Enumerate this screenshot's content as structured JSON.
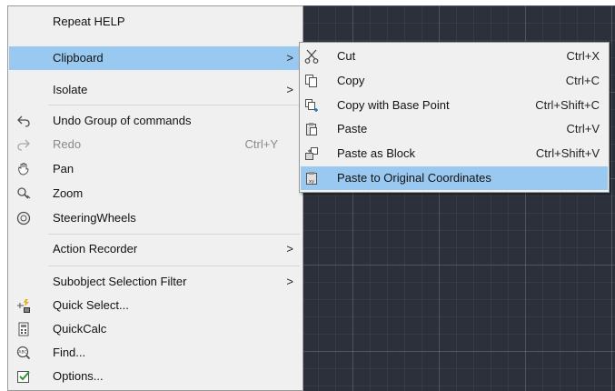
{
  "main_menu": {
    "items": [
      {
        "label": "Repeat HELP",
        "shortcut": "",
        "icon": "",
        "has_submenu": false
      },
      {
        "label": "Clipboard",
        "shortcut": "",
        "icon": "",
        "has_submenu": true,
        "highlighted": true
      },
      {
        "label": "Isolate",
        "shortcut": "",
        "icon": "",
        "has_submenu": true
      },
      {
        "label": "Undo Group of commands",
        "shortcut": "",
        "icon": "undo-icon",
        "has_submenu": false
      },
      {
        "label": "Redo",
        "shortcut": "Ctrl+Y",
        "icon": "redo-icon",
        "has_submenu": false,
        "disabled": true
      },
      {
        "label": "Pan",
        "shortcut": "",
        "icon": "pan-icon",
        "has_submenu": false
      },
      {
        "label": "Zoom",
        "shortcut": "",
        "icon": "zoom-icon",
        "has_submenu": false
      },
      {
        "label": "SteeringWheels",
        "shortcut": "",
        "icon": "steering-wheels-icon",
        "has_submenu": false
      },
      {
        "label": "Action Recorder",
        "shortcut": "",
        "icon": "",
        "has_submenu": true
      },
      {
        "label": "Subobject Selection Filter",
        "shortcut": "",
        "icon": "",
        "has_submenu": true
      },
      {
        "label": "Quick Select...",
        "shortcut": "",
        "icon": "quick-select-icon",
        "has_submenu": false
      },
      {
        "label": "QuickCalc",
        "shortcut": "",
        "icon": "calculator-icon",
        "has_submenu": false
      },
      {
        "label": "Find...",
        "shortcut": "",
        "icon": "find-icon",
        "has_submenu": false
      },
      {
        "label": "Options...",
        "shortcut": "",
        "icon": "options-icon",
        "has_submenu": false
      }
    ],
    "arrow_glyph": ">"
  },
  "clipboard_submenu": {
    "items": [
      {
        "label": "Cut",
        "shortcut": "Ctrl+X",
        "icon": "scissors-icon"
      },
      {
        "label": "Copy",
        "shortcut": "Ctrl+C",
        "icon": "copy-icon"
      },
      {
        "label": "Copy with Base Point",
        "shortcut": "Ctrl+Shift+C",
        "icon": "copy-base-point-icon"
      },
      {
        "label": "Paste",
        "shortcut": "Ctrl+V",
        "icon": "paste-icon"
      },
      {
        "label": "Paste as Block",
        "shortcut": "Ctrl+Shift+V",
        "icon": "paste-block-icon"
      },
      {
        "label": "Paste to Original Coordinates",
        "shortcut": "",
        "icon": "paste-original-coordinates-icon",
        "highlighted": true
      }
    ]
  },
  "colors": {
    "menu_background": "#f0f0f0",
    "highlight": "#99c9f0",
    "canvas_background": "#2b303b",
    "disabled_text": "#8a8a8a"
  }
}
